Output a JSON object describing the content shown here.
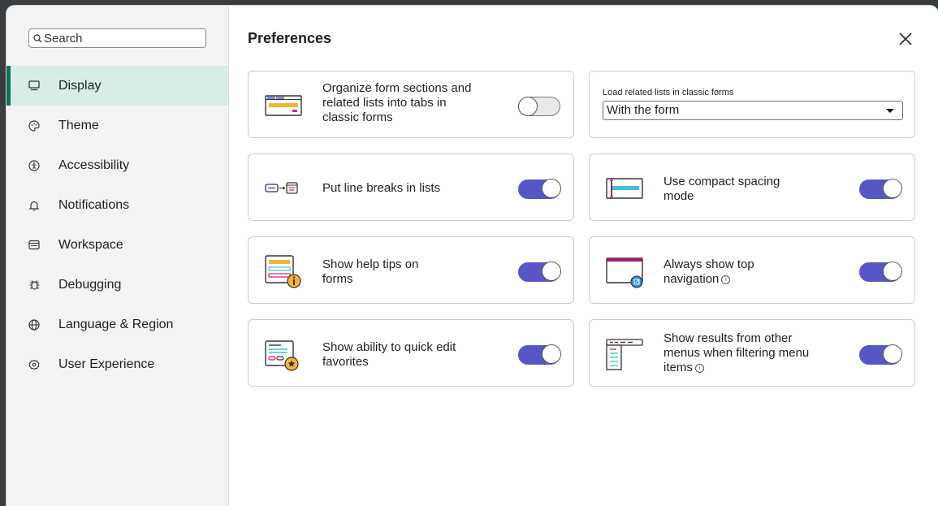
{
  "sidebar": {
    "search_placeholder": "Search",
    "items": [
      {
        "label": "Display",
        "icon": "monitor-icon",
        "active": true
      },
      {
        "label": "Theme",
        "icon": "palette-icon",
        "active": false
      },
      {
        "label": "Accessibility",
        "icon": "accessibility-icon",
        "active": false
      },
      {
        "label": "Notifications",
        "icon": "bell-icon",
        "active": false
      },
      {
        "label": "Workspace",
        "icon": "workspace-icon",
        "active": false
      },
      {
        "label": "Debugging",
        "icon": "bug-icon",
        "active": false
      },
      {
        "label": "Language & Region",
        "icon": "globe-icon",
        "active": false
      },
      {
        "label": "User Experience",
        "icon": "user-experience-icon",
        "active": false
      }
    ]
  },
  "main": {
    "title": "Preferences",
    "cards": {
      "tabs": {
        "line1": "Organize form sections and",
        "line2": "related lists into tabs in",
        "line3": "classic forms",
        "on": false
      },
      "related_lists": {
        "label": "Load related lists in classic forms",
        "value": "With the form"
      },
      "line_breaks": {
        "line1": "Put line breaks in lists",
        "on": true
      },
      "compact": {
        "line1": "Use compact spacing",
        "line2": "mode",
        "on": true
      },
      "help_tips": {
        "line1": "Show help tips on",
        "line2": "forms",
        "on": true
      },
      "top_nav": {
        "line1": "Always show top",
        "line2": "navigation",
        "on": true
      },
      "quick_edit": {
        "line1": "Show ability to quick edit",
        "line2": "favorites",
        "on": true
      },
      "other_menus": {
        "line1": "Show results from other",
        "line2": "menus when filtering menu",
        "line3": "items",
        "on": true
      }
    }
  },
  "colors": {
    "accent": "#5856c7",
    "active_nav_bg": "#d8ede5",
    "active_nav_bar": "#0d7354"
  }
}
